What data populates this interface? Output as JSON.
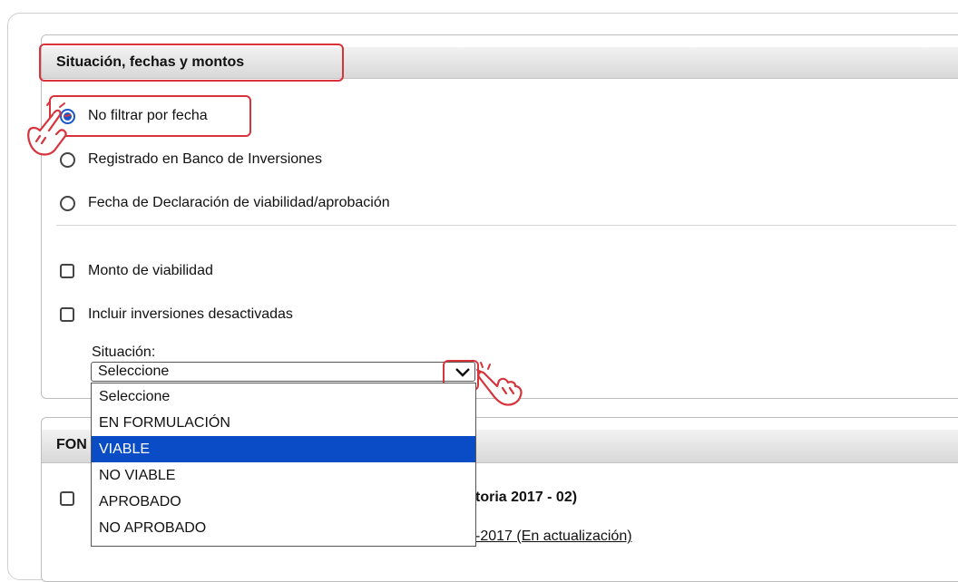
{
  "section1": {
    "title": "Situación, fechas y montos",
    "radios": [
      {
        "label": "No filtrar por fecha",
        "checked": true
      },
      {
        "label": "Registrado en Banco de Inversiones",
        "checked": false
      },
      {
        "label": "Fecha de Declaración de viabilidad/aprobación",
        "checked": false
      }
    ],
    "checkboxes": [
      {
        "label": "Monto de viabilidad",
        "checked": false
      },
      {
        "label": "Incluir inversiones desactivadas",
        "checked": false
      }
    ],
    "situacion_label": "Situación:",
    "select_value": "Seleccione",
    "options": [
      "Seleccione",
      "EN FORMULACIÓN",
      "VIABLE",
      "NO VIABLE",
      "APROBADO",
      "NO APROBADO"
    ],
    "highlighted_option": "VIABLE"
  },
  "section2": {
    "title_partial": "FON",
    "bold_tail": "toria 2017 - 02)",
    "link_tail": "-2017 (En actualización)"
  },
  "colors": {
    "accent_red": "#d8323b",
    "selection_blue": "#0a4cc5"
  }
}
